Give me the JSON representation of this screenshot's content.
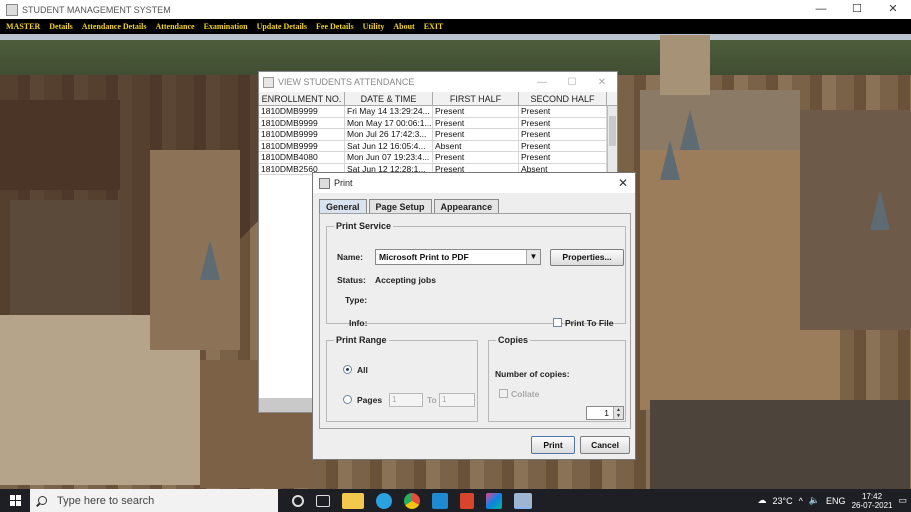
{
  "app": {
    "title": "STUDENT MANAGEMENT SYSTEM",
    "window_controls": [
      "—",
      "☐",
      "✕"
    ]
  },
  "menu": [
    "MASTER",
    "Details",
    "Attendance Details",
    "Attendance",
    "Examination",
    "Update Details",
    "Fee Details",
    "Utility",
    "About",
    "EXIT"
  ],
  "attendance_window": {
    "title": "VIEW STUDENTS ATTENDANCE",
    "columns": [
      "ENROLLMENT NO.",
      "DATE & TIME",
      "FIRST HALF",
      "SECOND HALF"
    ],
    "rows": [
      [
        "1810DMB9999",
        "Fri May 14 13:29:24...",
        "Present",
        "Present"
      ],
      [
        "1810DMB9999",
        "Mon May 17 00:06:1...",
        "Present",
        "Present"
      ],
      [
        "1810DMB9999",
        "Mon Jul 26 17:42:3...",
        "Present",
        "Present"
      ],
      [
        "1810DMB9999",
        "Sat Jun 12 16:05:4...",
        "Absent",
        "Present"
      ],
      [
        "1810DMB4080",
        "Mon Jun 07 19:23:4...",
        "Present",
        "Present"
      ],
      [
        "1810DMB2560",
        "Sat Jun 12 12:28:1...",
        "Present",
        "Absent"
      ]
    ]
  },
  "print_dialog": {
    "title": "Print",
    "tabs": [
      "General",
      "Page Setup",
      "Appearance"
    ],
    "print_service": {
      "heading": "Print Service",
      "name_label": "Name:",
      "name_value": "Microsoft Print to PDF",
      "properties_button": "Properties...",
      "status_label": "Status:",
      "status_value": "Accepting jobs",
      "type_label": "Type:",
      "info_label": "Info:",
      "print_to_file": "Print To File"
    },
    "print_range": {
      "heading": "Print Range",
      "all": "All",
      "pages": "Pages",
      "from": "1",
      "to_label": "To",
      "to": "1"
    },
    "copies": {
      "heading": "Copies",
      "number_label": "Number of copies:",
      "number_value": "1",
      "collate": "Collate"
    },
    "print_button": "Print",
    "cancel_button": "Cancel"
  },
  "taskbar": {
    "search_placeholder": "Type here to search",
    "weather": "23°C",
    "language": "ENG",
    "time": "17:42",
    "date": "26-07-2021",
    "icon_names": [
      "cortana-icon",
      "task-view-icon",
      "file-explorer-icon",
      "edge-icon",
      "chrome-icon",
      "vscode-icon",
      "office-icon",
      "app-icon",
      "java-icon"
    ]
  }
}
